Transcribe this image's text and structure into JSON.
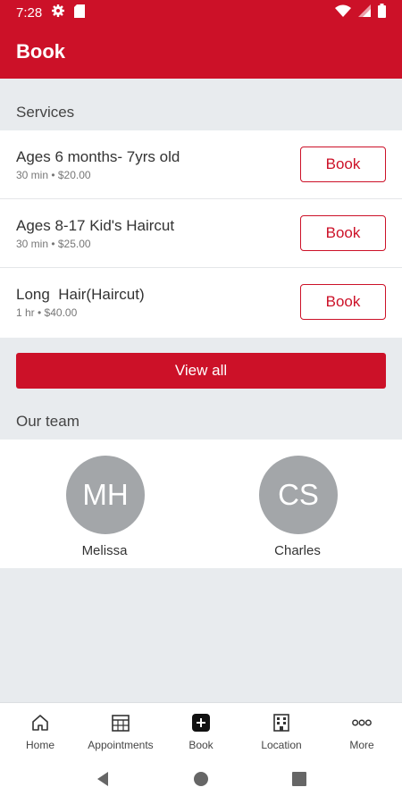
{
  "status_bar": {
    "time": "7:28"
  },
  "app_bar": {
    "title": "Book"
  },
  "services": {
    "label": "Services",
    "items": [
      {
        "name": "Ages 6 months- 7yrs old",
        "meta": "30 min • $20.00",
        "action": "Book"
      },
      {
        "name": "Ages 8-17 Kid's Haircut",
        "meta": "30 min • $25.00",
        "action": "Book"
      },
      {
        "name": "Long  Hair(Haircut)",
        "meta": "1 hr • $40.00",
        "action": "Book"
      }
    ],
    "view_all": "View all"
  },
  "team": {
    "label": "Our team",
    "members": [
      {
        "initials": "MH",
        "name": "Melissa"
      },
      {
        "initials": "CS",
        "name": "Charles"
      }
    ]
  },
  "bottom_nav": {
    "items": [
      {
        "label": "Home",
        "icon": "home-icon"
      },
      {
        "label": "Appointments",
        "icon": "calendar-icon"
      },
      {
        "label": "Book",
        "icon": "plus-icon"
      },
      {
        "label": "Location",
        "icon": "building-icon"
      },
      {
        "label": "More",
        "icon": "more-icon"
      }
    ]
  },
  "colors": {
    "brand": "#cc1128",
    "background": "#e8ebee",
    "avatar": "#a3a6a9"
  }
}
